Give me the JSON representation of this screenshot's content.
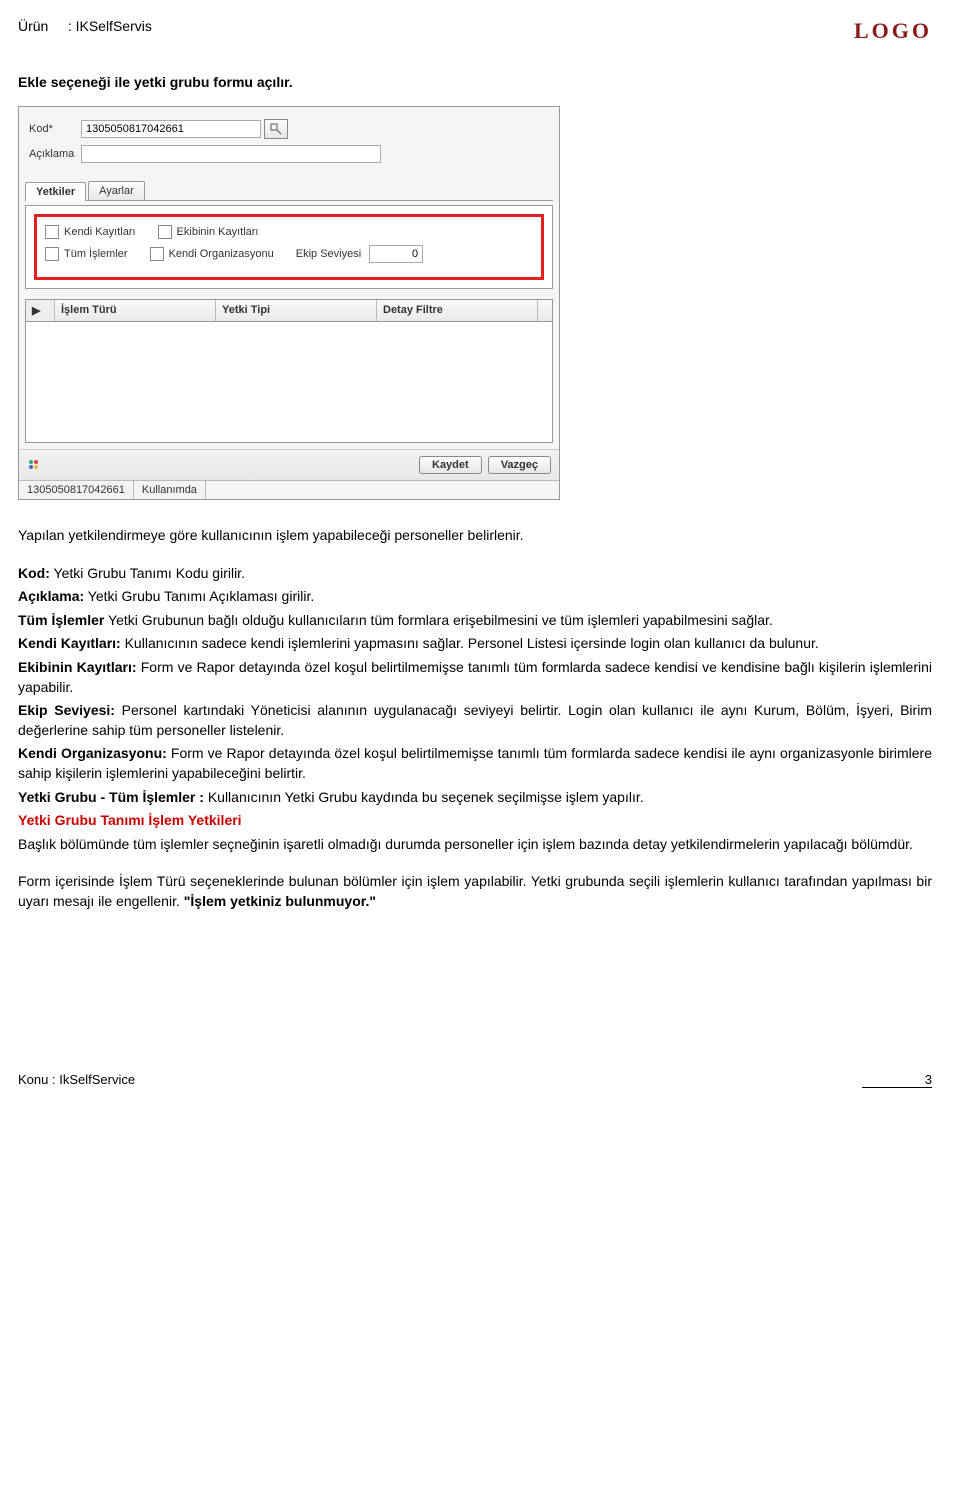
{
  "header": {
    "product_label": "Ürün",
    "product_sep": ":",
    "product_name": "IKSelfServis",
    "brand": "LOGO"
  },
  "intro": "Ekle seçeneği ile yetki grubu formu açılır.",
  "form": {
    "kod_label": "Kod*",
    "kod_value": "1305050817042661",
    "aciklama_label": "Açıklama",
    "aciklama_value": "",
    "tabs": {
      "yetkiler": "Yetkiler",
      "ayarlar": "Ayarlar"
    },
    "checkboxes": {
      "kendi_kayitlari": "Kendi Kayıtları",
      "ekibinin_kayitlari": "Ekibinin Kayıtları",
      "tum_islemler": "Tüm İşlemler",
      "kendi_organizasyonu": "Kendi Organizasyonu",
      "ekip_seviyesi_label": "Ekip Seviyesi",
      "ekip_seviyesi_value": "0"
    },
    "grid": {
      "col_handle": "▶",
      "col1": "İşlem Türü",
      "col2": "Yetki Tipi",
      "col3": "Detay Filtre"
    },
    "buttons": {
      "kaydet": "Kaydet",
      "vazgec": "Vazgeç"
    },
    "status": {
      "code": "1305050817042661",
      "state": "Kullanımda"
    }
  },
  "body": {
    "p1": "Yapılan yetkilendirmeye göre kullanıcının işlem yapabileceği personeller belirlenir.",
    "p2_b": "Kod:",
    "p2_t": " Yetki Grubu Tanımı Kodu girilir.",
    "p3_b": "Açıklama:",
    "p3_t": " Yetki Grubu Tanımı Açıklaması girilir.",
    "p4_b": "Tüm İşlemler",
    "p4_t": " Yetki Grubunun bağlı olduğu kullanıcıların tüm formlara erişebilmesini ve tüm işlemleri yapabilmesini sağlar.",
    "p5_b": "Kendi Kayıtları:",
    "p5_t": " Kullanıcının sadece kendi işlemlerini yapmasını sağlar. Personel Listesi içersinde login olan kullanıcı da bulunur.",
    "p6_b": "Ekibinin Kayıtları:",
    "p6_t": " Form ve Rapor detayında özel koşul belirtilmemişse tanımlı tüm formlarda sadece kendisi ve kendisine bağlı kişilerin işlemlerini yapabilir.",
    "p7_b": "Ekip Seviyesi:",
    "p7_t": " Personel kartındaki Yöneticisi alanının uygulanacağı seviyeyi belirtir. Login olan kullanıcı ile aynı Kurum, Bölüm, İşyeri, Birim değerlerine sahip tüm personeller listelenir.",
    "p8_b": "Kendi Organizasyonu:",
    "p8_t": " Form ve Rapor detayında özel koşul belirtilmemişse tanımlı tüm formlarda sadece kendisi ile aynı organizasyonle birimlere sahip kişilerin işlemlerini yapabileceğini belirtir.",
    "p9_b": "Yetki Grubu - Tüm İşlemler :",
    "p9_t": " Kullanıcının Yetki Grubu kaydında bu seçenek seçilmişse işlem yapılır.",
    "heading": "Yetki Grubu Tanımı İşlem Yetkileri",
    "p10": "Başlık bölümünde tüm işlemler seçneğinin işaretli olmadığı durumda personeller için işlem bazında detay yetkilendirmelerin yapılacağı bölümdür.",
    "p11_a": "Form içerisinde İşlem Türü seçeneklerinde bulunan bölümler için işlem yapılabilir. Yetki grubunda seçili işlemlerin kullanıcı tarafından yapılması bir uyarı mesajı ile engellenir. ",
    "p11_quote": "\"İşlem yetkiniz bulunmuyor.\""
  },
  "footer": {
    "konu_label": "Konu :",
    "konu_value": "IkSelfService",
    "page_no": "3"
  }
}
